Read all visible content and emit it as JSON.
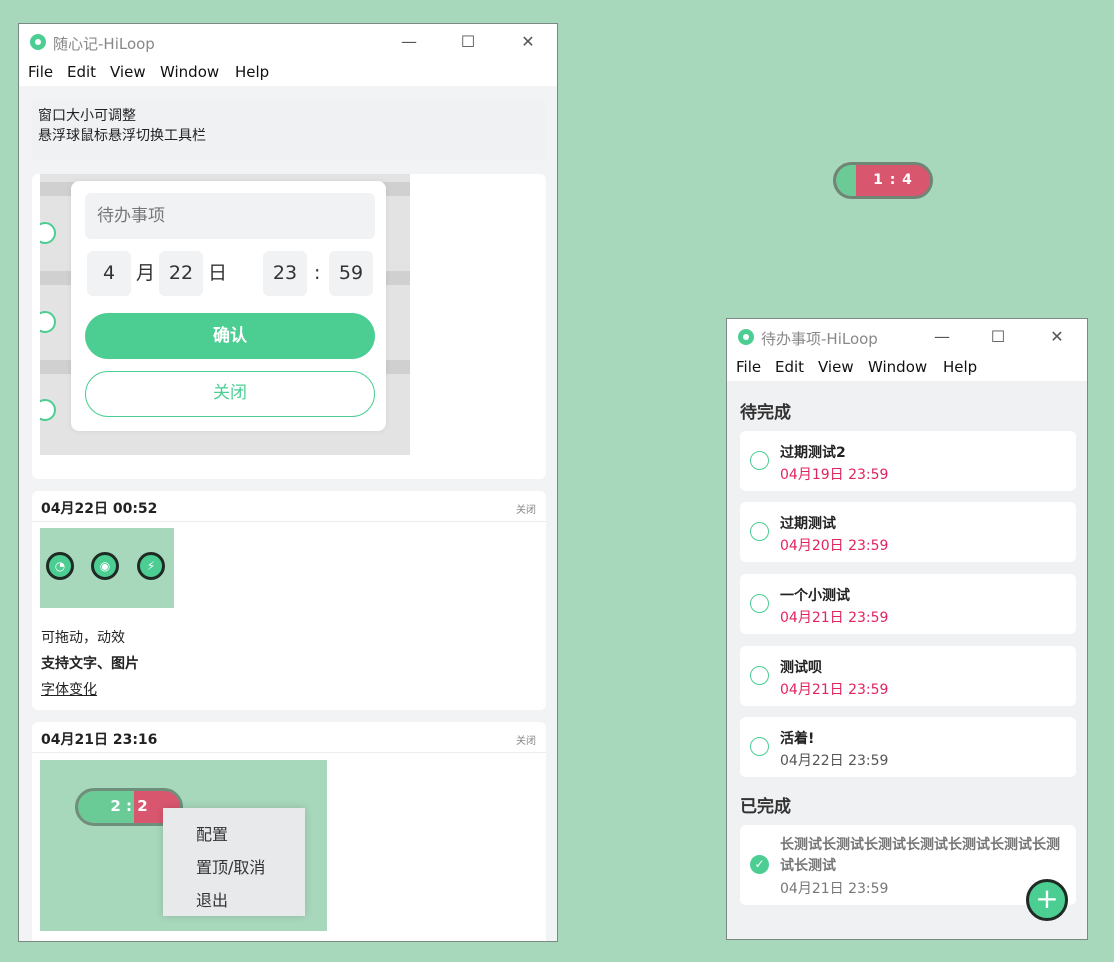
{
  "main_window": {
    "title": "随心记-HiLoop",
    "menu": [
      "File",
      "Edit",
      "View",
      "Window",
      "Help"
    ],
    "tip_lines": [
      "窗口大小可调整",
      "悬浮球鼠标悬浮切换工具栏"
    ],
    "popup": {
      "placeholder": "待办事项",
      "month": "4",
      "month_unit": "月",
      "day": "22",
      "day_unit": "日",
      "hour": "23",
      "sep": ":",
      "minute": "59",
      "confirm": "确认",
      "close": "关闭"
    },
    "cards": [
      {
        "date": "04月22日 00:52",
        "close": "关闭",
        "notes": [
          "可拖动，动效",
          "支持文字、图片",
          "字体变化"
        ]
      },
      {
        "date": "04月21日 23:16",
        "close": "关闭",
        "pill_text": "2 : 2",
        "context_menu": [
          "配置",
          "置顶/取消",
          "退出"
        ]
      }
    ]
  },
  "floating_ball": {
    "text": "1 : 4"
  },
  "todo_window": {
    "title": "待办事项-HiLoop",
    "menu": [
      "File",
      "Edit",
      "View",
      "Window",
      "Help"
    ],
    "pending_heading": "待完成",
    "pending": [
      {
        "name": "过期测试2",
        "due": "04月19日 23:59",
        "overdue": true
      },
      {
        "name": "过期测试",
        "due": "04月20日 23:59",
        "overdue": true
      },
      {
        "name": "一个小测试",
        "due": "04月21日 23:59",
        "overdue": true
      },
      {
        "name": "测试呗",
        "due": "04月21日 23:59",
        "overdue": true
      },
      {
        "name": "活着!",
        "due": "04月22日 23:59",
        "overdue": false
      }
    ],
    "done_heading": "已完成",
    "done": [
      {
        "name": "长测试长测试长测试长测试长测试长测试长测试长测试",
        "due": "04月21日 23:59"
      }
    ],
    "add_icon": "plus-icon"
  },
  "colors": {
    "background": "#a8d8bc",
    "accent": "#4cce93",
    "overdue": "#e0245e",
    "pill_red": "#d9566f"
  }
}
